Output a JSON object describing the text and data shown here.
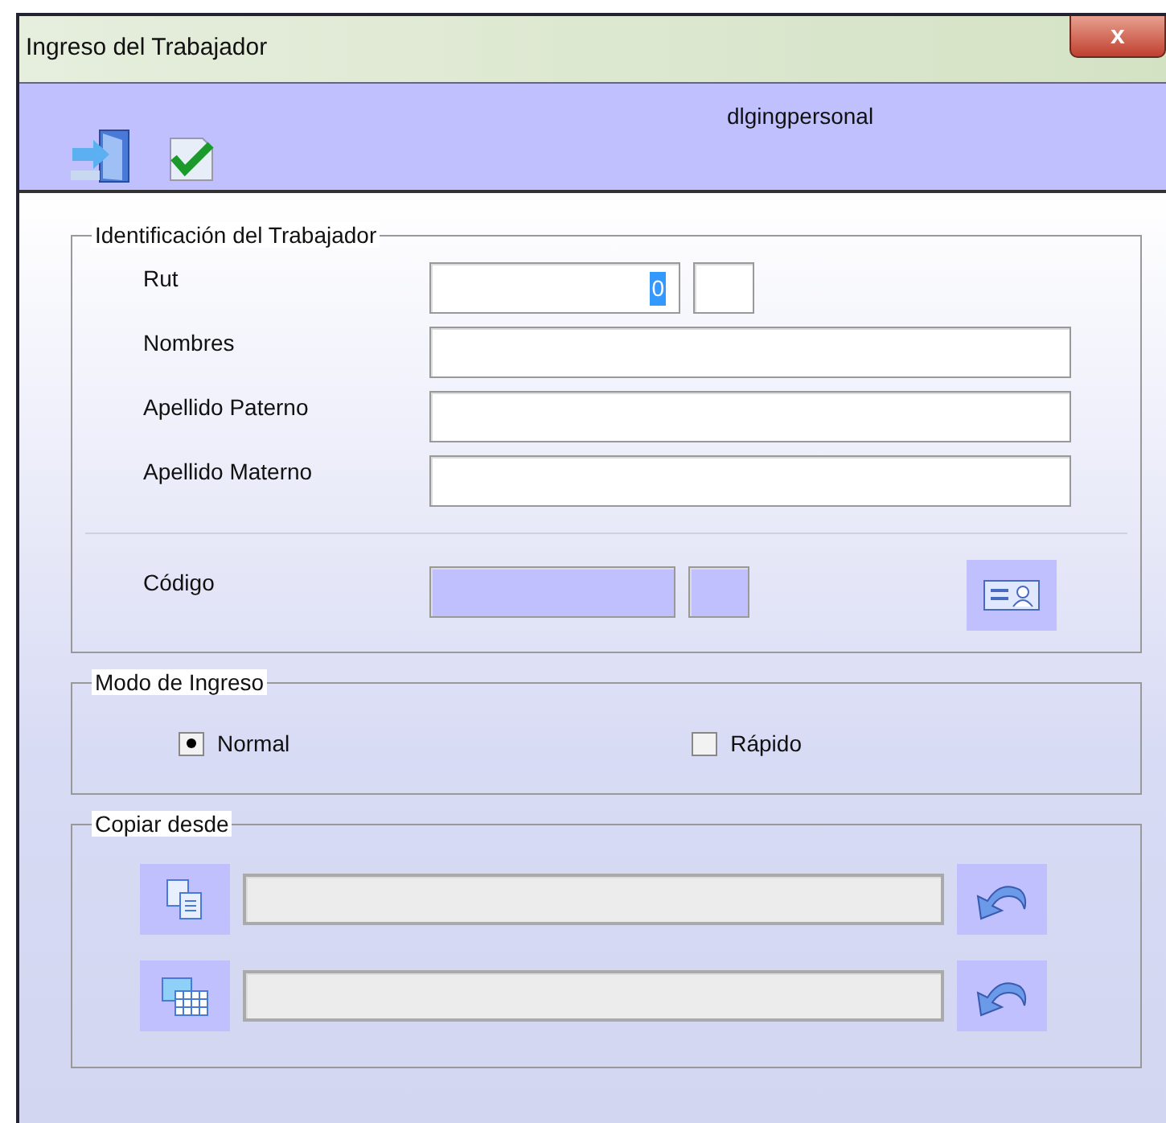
{
  "window": {
    "title": "Ingreso del Trabajador",
    "close_label": "x"
  },
  "toolbar": {
    "form_name": "dlgingpersonal"
  },
  "identification": {
    "legend": "Identificación del Trabajador",
    "rut": {
      "label": "Rut",
      "value": "0"
    },
    "fields": [
      {
        "label": "Nombres"
      },
      {
        "label": "Apellido Paterno"
      },
      {
        "label": "Apellido Materno"
      }
    ],
    "code": {
      "label": "Código"
    }
  },
  "mode": {
    "legend": "Modo de Ingreso",
    "options": [
      {
        "label": "Normal",
        "selected": true
      },
      {
        "label": "Rápido",
        "selected": false
      }
    ]
  },
  "copy_from": {
    "legend": "Copiar desde",
    "rows": [
      {
        "kind": "documents",
        "disabled": true
      },
      {
        "kind": "tables",
        "disabled": true
      }
    ]
  }
}
